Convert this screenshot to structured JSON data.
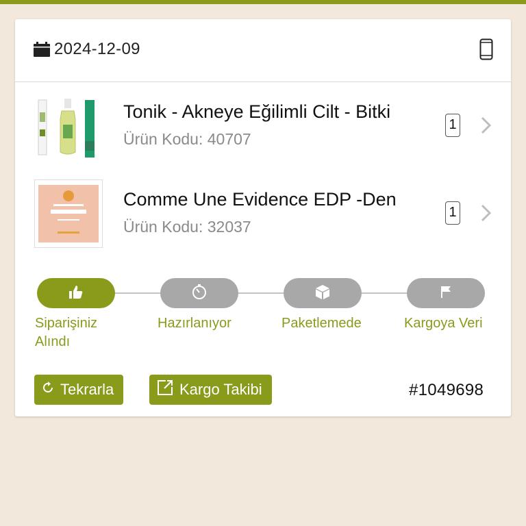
{
  "header": {
    "date": "2024-12-09",
    "icons": [
      "calendar-icon",
      "mobile-phone-icon"
    ]
  },
  "items": [
    {
      "title": "Tonik - Akneye Eğilimli Cilt - Bitki",
      "code": "Ürün Kodu: 40707",
      "quantity": "1"
    },
    {
      "title": "Comme Une Evidence EDP -Den",
      "code": "Ürün Kodu: 32037",
      "quantity": "1"
    }
  ],
  "steps": [
    {
      "label": "Siparişiniz\nAlındı",
      "icon": "thumbs-up-icon",
      "active": true
    },
    {
      "label": "Hazırlanıyor",
      "icon": "timer-icon",
      "active": false
    },
    {
      "label": "Paketlemede",
      "icon": "box-icon",
      "active": false
    },
    {
      "label": "Kargoya Veri",
      "icon": "flag-icon",
      "active": false
    }
  ],
  "actions": {
    "repeat_label": "Tekrarla",
    "tracking_label": "Kargo Takibi"
  },
  "order_number": "#1049698",
  "colors": {
    "accent": "#8a9a1b",
    "inactive": "#a8a8a8",
    "background": "#f3e8dc"
  }
}
